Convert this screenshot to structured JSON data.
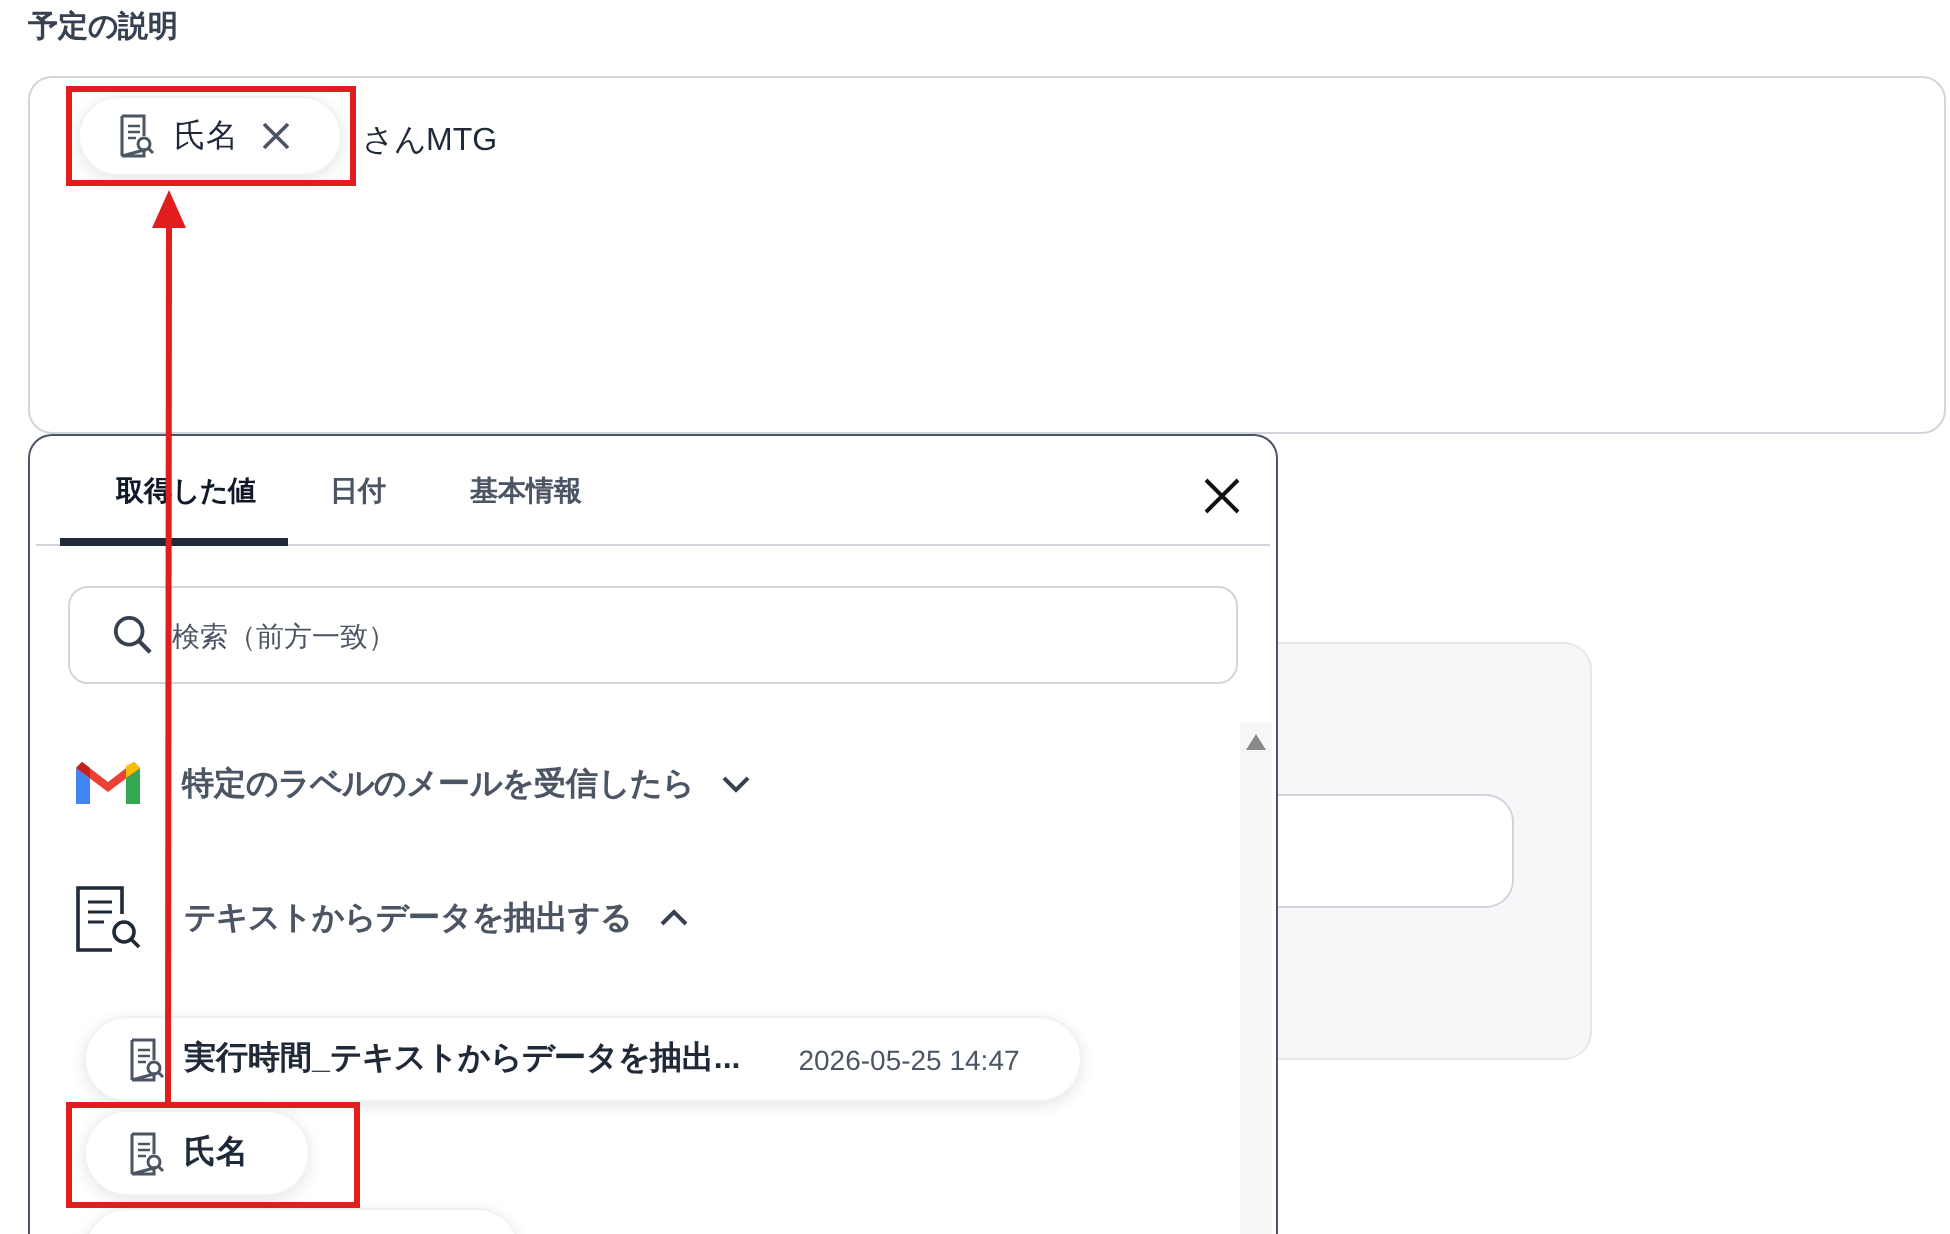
{
  "description": {
    "label": "予定の説明",
    "chip": "氏名",
    "text": "さんMTG"
  },
  "picker": {
    "tabs": [
      {
        "label": "取得した値",
        "selected": true
      },
      {
        "label": "日付",
        "selected": false
      },
      {
        "label": "基本情報",
        "selected": false
      }
    ],
    "search": {
      "placeholder": "検索（前方一致）"
    },
    "groups": [
      {
        "kind": "gmail",
        "title": "特定のラベルのメールを受信したら",
        "expanded": false
      },
      {
        "kind": "extract",
        "title": "テキストからデータを抽出する",
        "expanded": true,
        "items": [
          {
            "label": "実行時間_テキストからデータを抽出...",
            "value": "2026-05-25 14:47"
          },
          {
            "label": "氏名"
          }
        ]
      }
    ]
  }
}
